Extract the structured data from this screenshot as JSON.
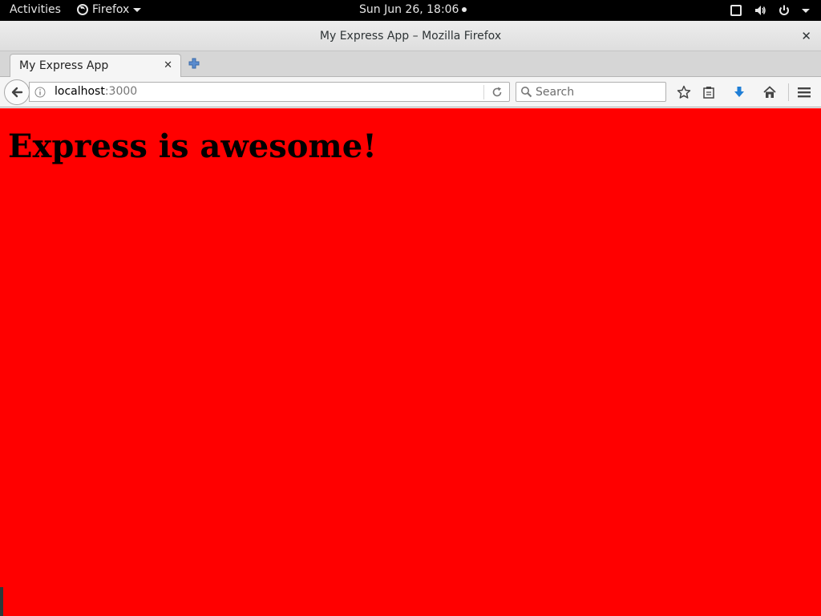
{
  "topbar": {
    "activities": "Activities",
    "app_name": "Firefox",
    "clock": "Sun Jun 26, 18:06"
  },
  "window": {
    "title": "My Express App – Mozilla Firefox"
  },
  "tabs": [
    {
      "label": "My Express App",
      "active": true
    }
  ],
  "navbar": {
    "url_host": "localhost",
    "url_port": ":3000",
    "search_placeholder": "Search"
  },
  "page": {
    "heading": "Express is awesome!",
    "background_color": "#ff0000"
  },
  "icons": {
    "firefox": "firefox-icon",
    "window_close": "close-icon",
    "tab_close": "close-icon",
    "new_tab": "plus-icon",
    "back": "back-arrow-icon",
    "site_info": "info-icon",
    "reload": "reload-icon",
    "search": "search-icon",
    "bookmark": "star-icon",
    "reading_list": "clipboard-icon",
    "downloads": "download-arrow-icon",
    "home": "home-icon",
    "menu": "hamburger-menu-icon",
    "window_toggle": "window-icon",
    "volume": "volume-icon",
    "power": "power-icon"
  }
}
